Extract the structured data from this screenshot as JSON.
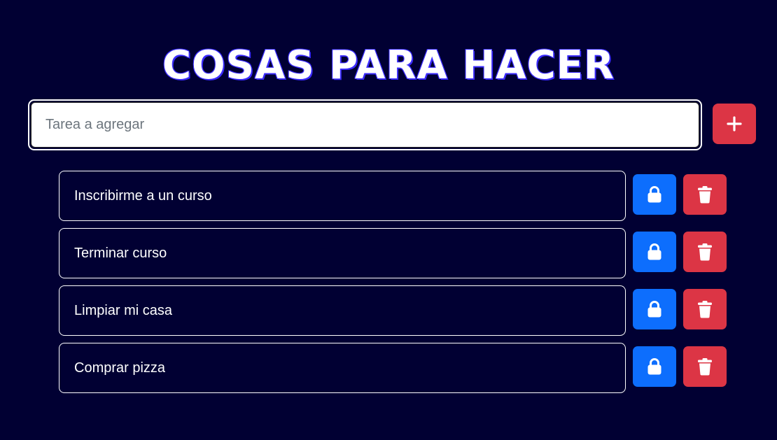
{
  "header": {
    "title": "COSAS PARA HACER"
  },
  "new_task": {
    "placeholder": "Tarea a agregar",
    "value": "",
    "add_icon": "plus-icon"
  },
  "tasks": [
    {
      "label": "Inscribirme a un curso",
      "lock_icon": "lock-icon",
      "delete_icon": "trash-icon"
    },
    {
      "label": "Terminar curso",
      "lock_icon": "lock-icon",
      "delete_icon": "trash-icon"
    },
    {
      "label": "Limpiar mi casa",
      "lock_icon": "lock-icon",
      "delete_icon": "trash-icon"
    },
    {
      "label": "Comprar pizza",
      "lock_icon": "lock-icon",
      "delete_icon": "trash-icon"
    }
  ],
  "colors": {
    "background": "#010033",
    "title_shadow": "#3b2bff",
    "lock_button": "#0d6efd",
    "delete_button": "#dc3545",
    "add_button": "#dc3545"
  }
}
